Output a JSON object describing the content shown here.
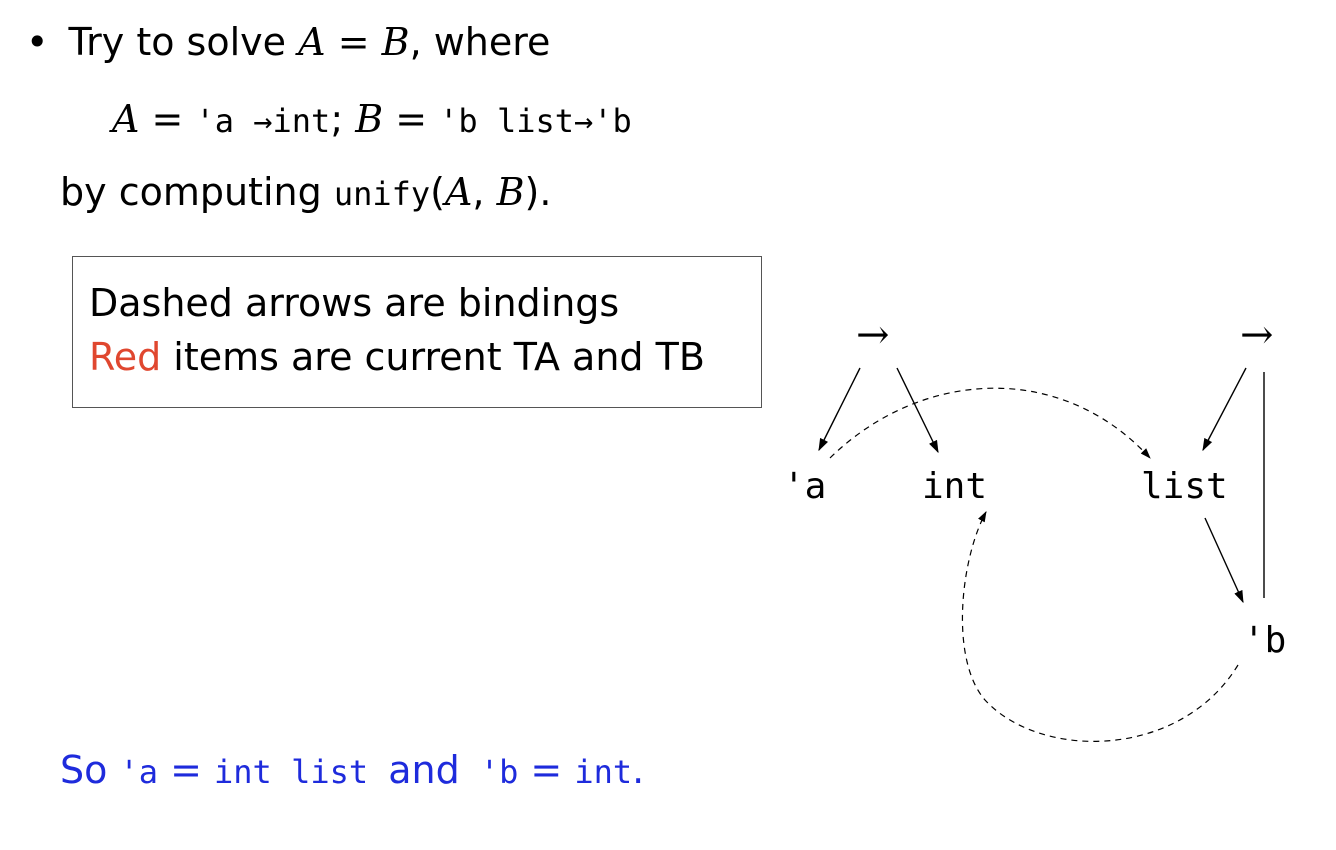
{
  "line1": {
    "bullet": "•",
    "prefix": "Try to solve",
    "a": "A",
    "eq": "=",
    "b": "B",
    "suffix": ", where"
  },
  "line2": {
    "a": "A",
    "eq1": " = ",
    "a_type": "'a →int",
    "sep": "; ",
    "b": "B",
    "eq2": " = ",
    "b_type": "'b list→'b"
  },
  "line3": {
    "prefix": "by computing",
    "func": "unify",
    "args_open": "(",
    "arg_a": "A",
    "comma": ", ",
    "arg_b": "B",
    "args_close": ")."
  },
  "legend": {
    "line1": "Dashed arrows are bindings",
    "red_word": "Red",
    "line2_rest": " items are current TA and TB"
  },
  "diagram": {
    "arrow_left": "→",
    "arrow_right": "→",
    "node_a": "'a",
    "node_int": "int",
    "node_list": "list",
    "node_b": "'b"
  },
  "conclusion": {
    "so": "So",
    "var_a": "'a",
    "eq1": " = ",
    "val_a": "int list",
    "and": "and",
    "var_b": "'b",
    "eq2": " = ",
    "val_b": "int",
    "period": "."
  },
  "colors": {
    "conclusion": "#1e2bdc",
    "highlight": "#e0472f"
  }
}
